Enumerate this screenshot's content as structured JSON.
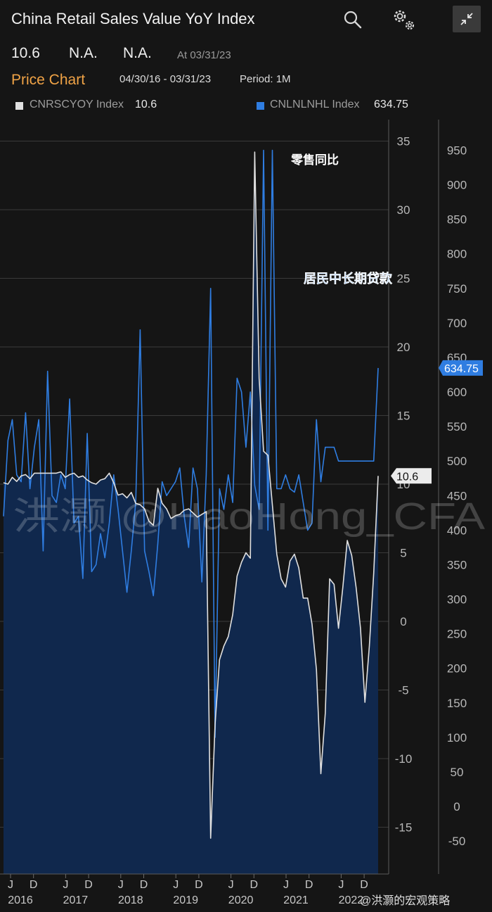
{
  "header": {
    "title": "China Retail Sales Value YoY Index",
    "last_value": "10.6",
    "change": "N.A.",
    "pct_change": "N.A.",
    "as_of": "At 03/31/23",
    "chart_label": "Price Chart",
    "date_range": "04/30/16 - 03/31/23",
    "period": "Period: 1M"
  },
  "legend": [
    {
      "ticker": "CNRSCYOY Index",
      "last": "10.6",
      "color": "#e0e0e0"
    },
    {
      "ticker": "CNLNLNHL Index",
      "last": "634.75",
      "color": "#2f7de1"
    }
  ],
  "icons": [
    "search-icon",
    "settings-icon",
    "collapse-icon"
  ],
  "watermark": "洪灏 @HaoHong_CFA",
  "source_mark": "@洪灏的宏观策略",
  "chart_data": {
    "type": "line",
    "annotations": [
      "零售同比",
      "居民中长期贷款"
    ],
    "left_axis": {
      "ticks": [
        "35",
        "30",
        "25",
        "20",
        "15",
        "10",
        "5",
        "0",
        "-5",
        "-10",
        "-15"
      ],
      "range": [
        -18,
        35
      ]
    },
    "right_axis": {
      "ticks": [
        "950",
        "900",
        "850",
        "800",
        "750",
        "700",
        "650",
        "600",
        "550",
        "500",
        "450",
        "400",
        "350",
        "300",
        "250",
        "200",
        "150",
        "100",
        "50",
        "0",
        "-50"
      ],
      "range": [
        -90,
        1000
      ]
    },
    "x_ticks": [
      {
        "label": "J",
        "year": "2016",
        "pos": 0.25
      },
      {
        "label": "D",
        "year": "",
        "pos": 0.667
      },
      {
        "label": "J",
        "year": "2017",
        "pos": 1.25
      },
      {
        "label": "D",
        "year": "",
        "pos": 1.667
      },
      {
        "label": "J",
        "year": "2018",
        "pos": 2.25
      },
      {
        "label": "D",
        "year": "",
        "pos": 2.667
      },
      {
        "label": "J",
        "year": "2019",
        "pos": 3.25
      },
      {
        "label": "D",
        "year": "",
        "pos": 3.667
      },
      {
        "label": "J",
        "year": "2020",
        "pos": 4.25
      },
      {
        "label": "D",
        "year": "",
        "pos": 4.667
      },
      {
        "label": "J",
        "year": "2021",
        "pos": 5.25
      },
      {
        "label": "D",
        "year": "",
        "pos": 5.667
      },
      {
        "label": "J",
        "year": "2022",
        "pos": 6.25
      },
      {
        "label": "D",
        "year": "",
        "pos": 6.667
      }
    ],
    "series": [
      {
        "name": "CNRSCYOY Index",
        "axis": "left",
        "color": "#e0e0e0",
        "fill": "#10284d",
        "last_label": "10.6",
        "values": [
          10.1,
          10.0,
          10.5,
          10.2,
          10.6,
          10.7,
          10.4,
          10.8,
          10.8,
          10.8,
          10.8,
          10.8,
          10.8,
          10.9,
          10.5,
          10.7,
          10.8,
          10.5,
          10.6,
          10.3,
          10.1,
          10.0,
          10.3,
          10.4,
          10.8,
          10.1,
          9.2,
          9.3,
          9.0,
          9.4,
          8.6,
          8.5,
          8.2,
          7.3,
          7.0,
          9.7,
          8.6,
          8.2,
          7.5,
          7.7,
          7.8,
          8.1,
          8.2,
          7.9,
          7.6,
          7.8,
          8.0,
          -15.8,
          -7.5,
          -2.8,
          -1.8,
          -1.1,
          0.5,
          3.3,
          4.3,
          5.0,
          4.6,
          34.2,
          17.7,
          12.4,
          12.1,
          8.5,
          4.9,
          3.1,
          2.5,
          4.4,
          4.9,
          3.9,
          1.7,
          1.7,
          -0.2,
          -3.5,
          -11.1,
          -6.7,
          3.1,
          2.7,
          -0.5,
          2.5,
          5.9,
          4.8,
          2.5,
          -0.5,
          -5.9,
          -1.8,
          3.5,
          10.6
        ]
      },
      {
        "name": "CNLNLNHL Index",
        "axis": "right",
        "color": "#2f7de1",
        "last_label": "634.75",
        "values": [
          420,
          530,
          560,
          480,
          470,
          570,
          460,
          520,
          560,
          370,
          630,
          450,
          440,
          480,
          460,
          590,
          410,
          420,
          330,
          540,
          340,
          350,
          395,
          360,
          410,
          480,
          430,
          370,
          310,
          370,
          440,
          690,
          370,
          340,
          305,
          380,
          470,
          450,
          460,
          470,
          490,
          420,
          375,
          490,
          460,
          325,
          480,
          750,
          100,
          460,
          430,
          480,
          440,
          620,
          600,
          520,
          600,
          465,
          430,
          950,
          400,
          950,
          460,
          460,
          480,
          460,
          455,
          480,
          440,
          400,
          410,
          560,
          470,
          520,
          520,
          520,
          500,
          500,
          500,
          500,
          500,
          500,
          500,
          500,
          500,
          634.75
        ]
      }
    ]
  }
}
